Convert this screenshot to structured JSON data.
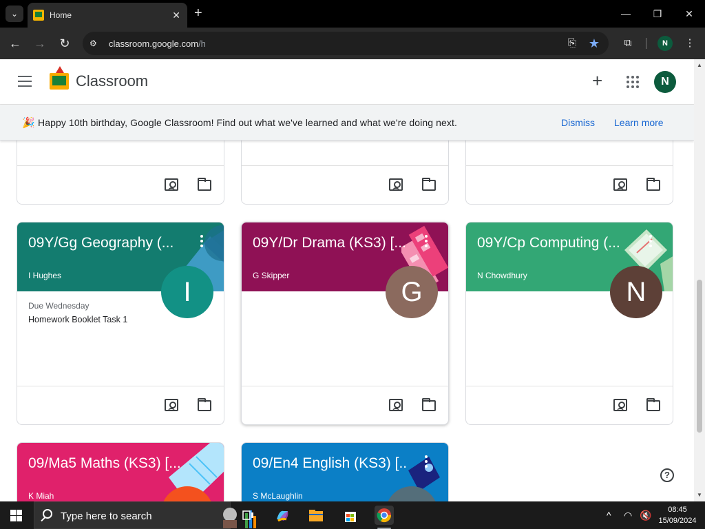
{
  "browser": {
    "tab_title": "Home",
    "url_host": "classroom.google.com",
    "url_path": "/h",
    "profile_initial": "N"
  },
  "header": {
    "app_name": "Classroom",
    "avatar_initial": "N",
    "avatar_color": "#0c5b3d"
  },
  "banner": {
    "text": "Happy 10th birthday, Google Classroom! Find out what we've learned and what we're doing next.",
    "dismiss": "Dismiss",
    "learn_more": "Learn more"
  },
  "cards": [
    {
      "title": "09Y/Gg Geography (...",
      "teacher": "I Hughes",
      "initial": "I",
      "header_color": "#137c6f",
      "avatar_color": "#129185",
      "due_label": "Due Wednesday",
      "due_task": "Homework Booklet Task 1"
    },
    {
      "title": "09Y/Dr Drama (KS3) [...",
      "teacher": "G Skipper",
      "initial": "G",
      "header_color": "#8f1155",
      "avatar_color": "#8b6a5e",
      "due_label": "",
      "due_task": ""
    },
    {
      "title": "09Y/Cp Computing (...",
      "teacher": "N Chowdhury",
      "initial": "N",
      "header_color": "#33a775",
      "avatar_color": "#5d4037",
      "due_label": "",
      "due_task": ""
    },
    {
      "title": "09/Ma5 Maths (KS3) [...",
      "teacher": "K Miah",
      "header_color": "#e0216b",
      "avatar_color": "#f4511e"
    },
    {
      "title": "09/En4 English (KS3) [...",
      "teacher": "S McLaughlin",
      "header_color": "#0b7fc6",
      "avatar_color": "#546e7a"
    }
  ],
  "taskbar": {
    "search_placeholder": "Type here to search",
    "time": "08:45",
    "date": "15/09/2024"
  }
}
